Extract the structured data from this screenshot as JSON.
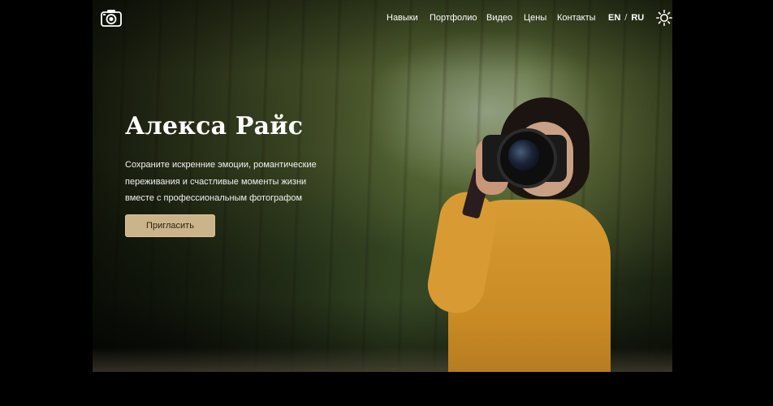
{
  "nav": {
    "items": [
      "Навыки",
      "Портфолио",
      "Видео",
      "Цены",
      "Контакты"
    ],
    "lang_en": "EN",
    "lang_sep": "/",
    "lang_ru": "RU"
  },
  "hero": {
    "title": "Алекса Райс",
    "description": "Сохраните искренние эмоции, романтические переживания и счастливые моменты жизни вместе с профессиональным фотографом",
    "button_label": "Пригласить"
  },
  "icons": {
    "logo": "camera-icon",
    "theme_toggle": "sun-icon"
  },
  "colors": {
    "accent": "#cbb489",
    "background": "#000000",
    "text": "#ffffff"
  }
}
